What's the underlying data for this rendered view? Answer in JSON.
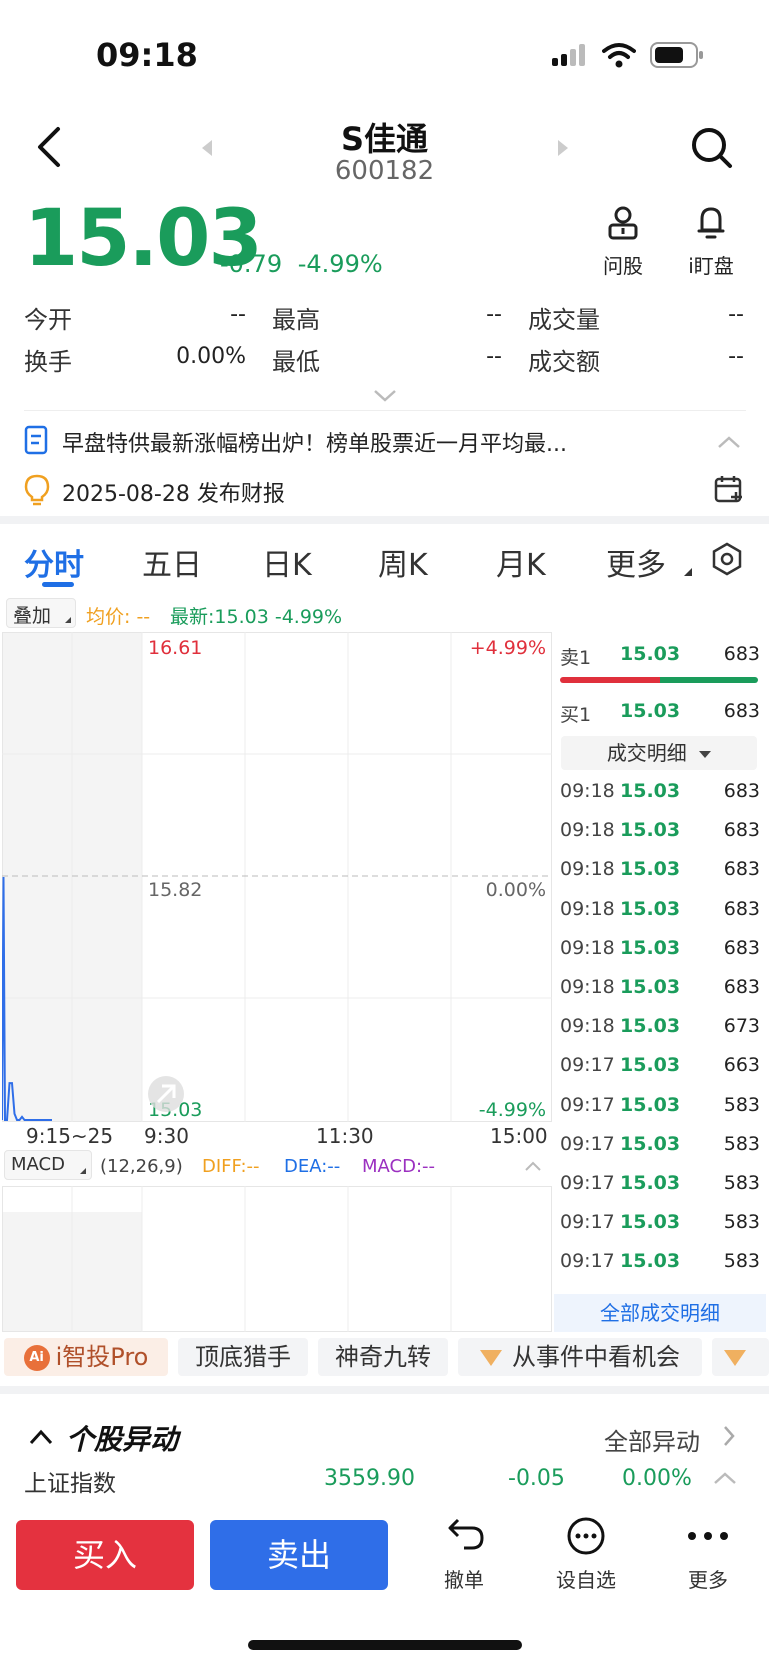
{
  "status": {
    "time": "09:18"
  },
  "header": {
    "name": "S佳通",
    "code": "600182"
  },
  "quote": {
    "price": "15.03",
    "change": "-0.79",
    "change_pct": "-4.99%"
  },
  "tools": {
    "ask_label": "问股",
    "watch_label": "i盯盘"
  },
  "stats": {
    "open_label": "今开",
    "open_val": "--",
    "high_label": "最高",
    "high_val": "--",
    "volume_label": "成交量",
    "volume_val": "--",
    "turnover_label": "换手",
    "turnover_val": "0.00%",
    "low_label": "最低",
    "low_val": "--",
    "amount_label": "成交额",
    "amount_val": "--"
  },
  "news": {
    "headline": "早盘特供最新涨幅榜出炉！榜单股票近一月平均最...",
    "report": "2025-08-28 发布财报"
  },
  "tabs": [
    "分时",
    "五日",
    "日K",
    "周K",
    "月K",
    "更多"
  ],
  "chart_controls": {
    "overlay_label": "叠加",
    "avg_label": "均价: --",
    "latest_label": "最新:15.03 -4.99%"
  },
  "chart_data": {
    "type": "line",
    "title": "",
    "xlabel": "",
    "ylabel": "",
    "x_ticks": [
      "9:15~25",
      "9:30",
      "11:30",
      "15:00"
    ],
    "y_ticks_left": [
      "16.61",
      "15.82",
      "15.03"
    ],
    "y_ticks_right": [
      "+4.99%",
      "0.00%",
      "-4.99%"
    ],
    "ylim": [
      15.03,
      16.61
    ],
    "series": [
      {
        "x": [
          0,
          0.3,
          0.6,
          1,
          1.5,
          2,
          2.5,
          3,
          3.5,
          4,
          4.5,
          5,
          6,
          7,
          8,
          9,
          10
        ],
        "values": [
          15.03,
          15.82,
          15.03,
          15.03,
          15.15,
          15.15,
          15.05,
          15.03,
          15.03,
          15.04,
          15.03,
          15.03,
          15.03,
          15.03,
          15.03,
          15.03,
          15.03
        ]
      }
    ]
  },
  "macd": {
    "label": "MACD",
    "params": "(12,26,9)",
    "diff": "DIFF:--",
    "dea": "DEA:--",
    "macd": "MACD:--"
  },
  "order_book": {
    "sell1_label": "卖1",
    "sell1_price": "15.03",
    "sell1_vol": "683",
    "buy1_label": "买1",
    "buy1_price": "15.03",
    "buy1_vol": "683",
    "detail_label": "成交明细",
    "all_detail_label": "全部成交明细"
  },
  "trades": [
    {
      "t": "09:18",
      "p": "15.03",
      "v": "683"
    },
    {
      "t": "09:18",
      "p": "15.03",
      "v": "683"
    },
    {
      "t": "09:18",
      "p": "15.03",
      "v": "683"
    },
    {
      "t": "09:18",
      "p": "15.03",
      "v": "683"
    },
    {
      "t": "09:18",
      "p": "15.03",
      "v": "683"
    },
    {
      "t": "09:18",
      "p": "15.03",
      "v": "683"
    },
    {
      "t": "09:18",
      "p": "15.03",
      "v": "673"
    },
    {
      "t": "09:17",
      "p": "15.03",
      "v": "663"
    },
    {
      "t": "09:17",
      "p": "15.03",
      "v": "583"
    },
    {
      "t": "09:17",
      "p": "15.03",
      "v": "583"
    },
    {
      "t": "09:17",
      "p": "15.03",
      "v": "583"
    },
    {
      "t": "09:17",
      "p": "15.03",
      "v": "583"
    },
    {
      "t": "09:17",
      "p": "15.03",
      "v": "583"
    }
  ],
  "feature_chips": [
    "i智投Pro",
    "顶底猎手",
    "神奇九转",
    "从事件中看机会"
  ],
  "anomaly": {
    "title": "个股异动",
    "all_label": "全部异动"
  },
  "index_row": {
    "name": "上证指数",
    "value": "3559.90",
    "change": "-0.05",
    "pct": "0.00%"
  },
  "bottom": {
    "buy_label": "买入",
    "sell_label": "卖出",
    "cancel_label": "撤单",
    "fav_label": "设自选",
    "more_label": "更多"
  }
}
